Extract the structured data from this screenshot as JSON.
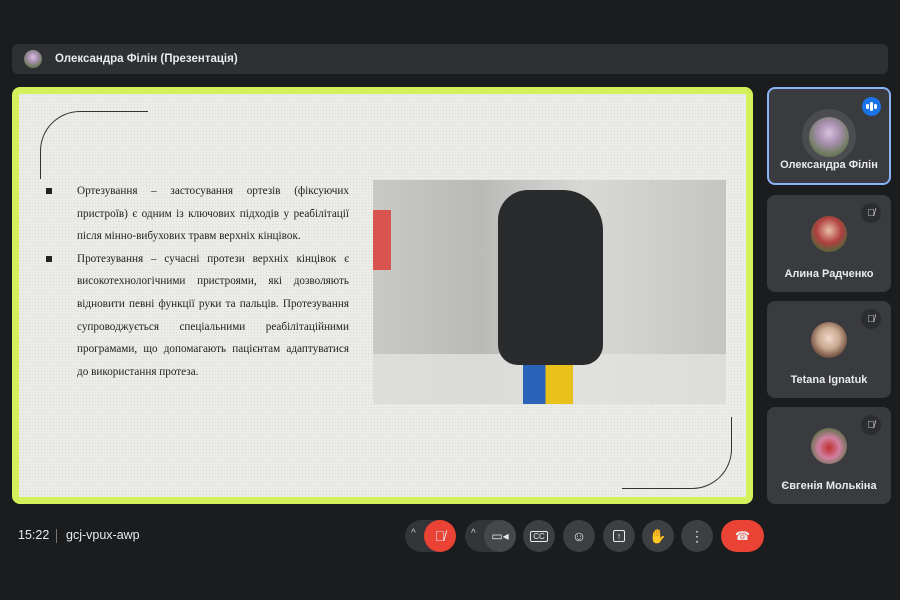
{
  "topbar": {
    "presenter_label": "Олександра Філін (Презентація)"
  },
  "slide": {
    "bullets": [
      "Ортезування – застосування ортезів (фіксуючих пристроїв) є одним із ключових підходів у реабілітації після мінно-вибухових травм верхніх кінцівок.",
      "Протезування – сучасні протези верхніх кінцівок є високотехнологічними пристроями, які дозволяють відновити певні функції руки та пальців. Протезування супроводжується спеціальними реабілітаційними програмами, що допомагають пацієнтам адаптуватися до використання протеза."
    ]
  },
  "participants": [
    {
      "name": "Олександра Філін",
      "speaking": true
    },
    {
      "name": "Алина Радченко",
      "muted": true
    },
    {
      "name": "Tetana Ignatuk",
      "muted": true
    },
    {
      "name": "Євгенія Молькіна",
      "muted": true
    }
  ],
  "meeting": {
    "time": "15:22",
    "code": "gcj-vpux-awp"
  },
  "colors": {
    "accent": "#d4f05b",
    "end_call": "#ea4335",
    "speaking": "#1a73e8"
  }
}
